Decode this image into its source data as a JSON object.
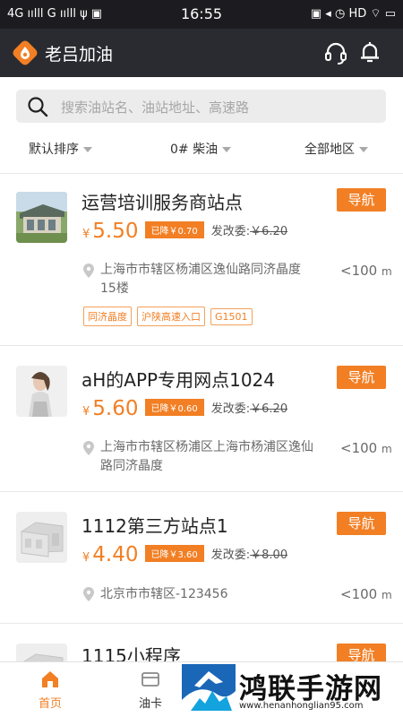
{
  "status_bar": {
    "left": "4G ıılll G ıılll ψ ▣",
    "time": "16:55",
    "right": "▣ ◂ ◷ HD ⌔ ▭"
  },
  "app": {
    "title": "老吕加油"
  },
  "search": {
    "placeholder": "搜索油站名、油站地址、高速路"
  },
  "filters": {
    "sort": "默认排序",
    "fuel": "0# 柴油",
    "region": "全部地区"
  },
  "stations": [
    {
      "name": "运营培训服务商站点",
      "nav_label": "导航",
      "currency": "¥",
      "price": "5.50",
      "discount": "已降￥0.70",
      "ref_label": "发改委:",
      "ref_price": "￥6.20",
      "address": "上海市市辖区杨浦区逸仙路同济晶度15楼",
      "distance": "<100",
      "distance_unit": "m",
      "tags": [
        "同济晶度",
        "沪陕高速入口",
        "G1501"
      ]
    },
    {
      "name": "aH的APP专用网点1024",
      "nav_label": "导航",
      "currency": "¥",
      "price": "5.60",
      "discount": "已降￥0.60",
      "ref_label": "发改委:",
      "ref_price": "￥6.20",
      "address": "上海市市辖区杨浦区上海市杨浦区逸仙路同济晶度",
      "distance": "<100",
      "distance_unit": "m",
      "tags": []
    },
    {
      "name": "1112第三方站点1",
      "nav_label": "导航",
      "currency": "¥",
      "price": "4.40",
      "discount": "已降￥3.60",
      "ref_label": "发改委:",
      "ref_price": "￥8.00",
      "address": "北京市市辖区-123456",
      "distance": "<100",
      "distance_unit": "m",
      "tags": []
    },
    {
      "name": "1115小程序",
      "nav_label": "导航"
    }
  ],
  "tabbar": {
    "home": "首页",
    "card": "油卡"
  },
  "watermark": {
    "title": "鸿联手游网",
    "url": "www.henanhonglian95.com"
  },
  "colors": {
    "accent": "#f27f24",
    "appbar": "#2a2b30",
    "statusbar": "#1c1c20"
  }
}
